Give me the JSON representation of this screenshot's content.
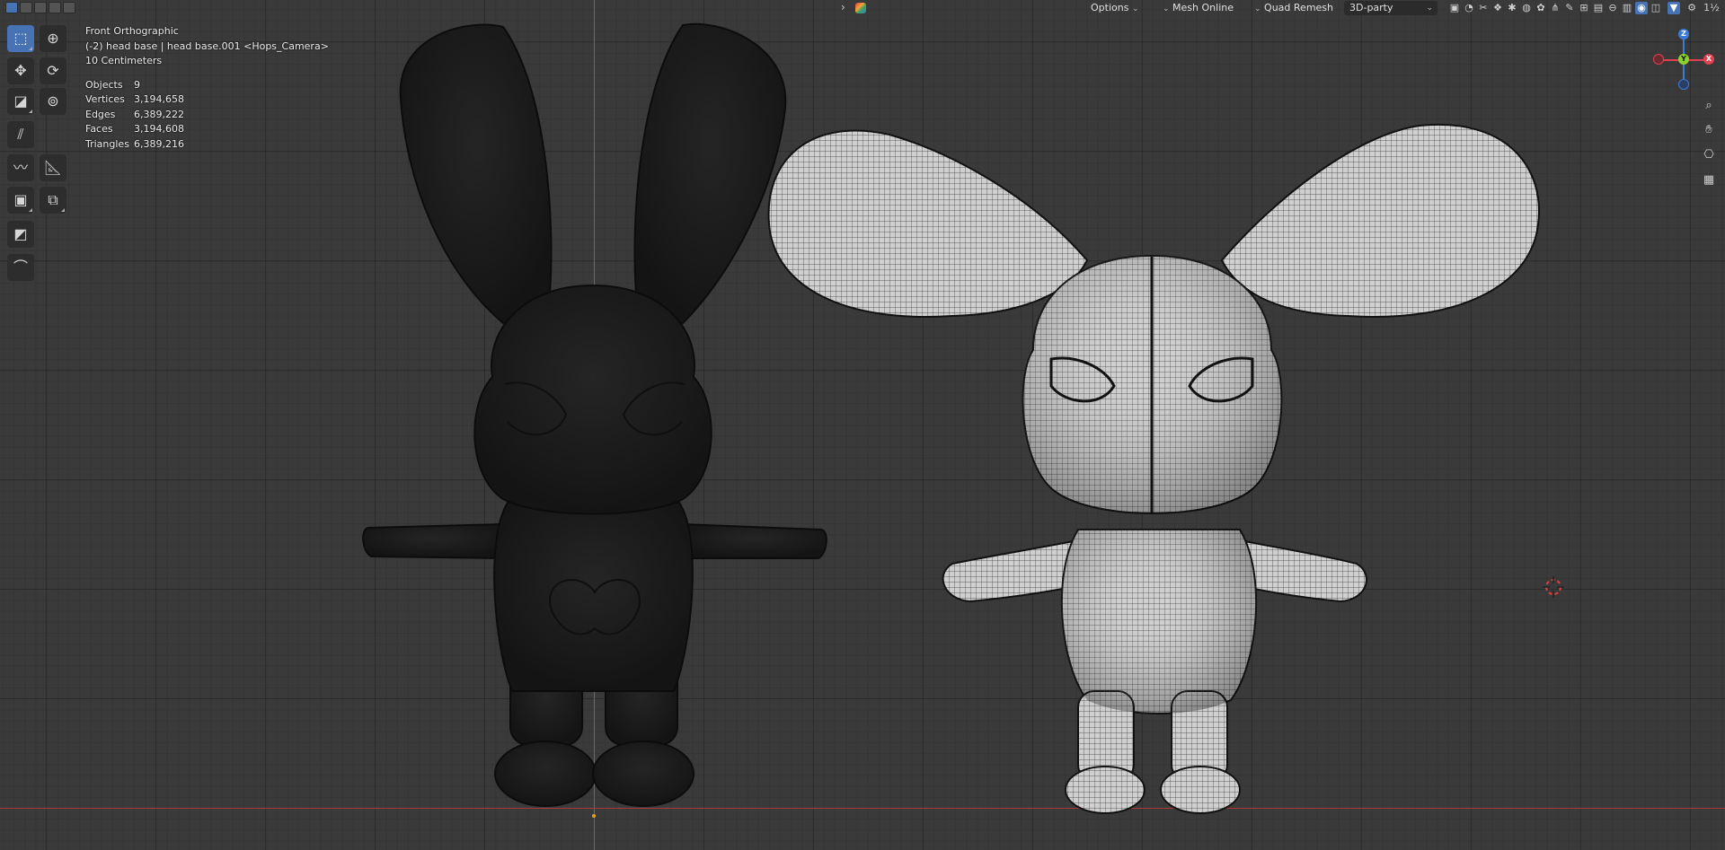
{
  "header": {
    "mode_icons": [
      "select-box-icon",
      "select-extend-icon",
      "select-subtract-icon",
      "select-invert-icon",
      "select-intersect-icon"
    ],
    "options_label": "Options",
    "mesh_online_label": "Mesh Online",
    "quad_remesh_label": "Quad Remesh",
    "addon_select_value": "3D-party",
    "right_icons": [
      "viewport-settings-icon",
      "gizmo-icon",
      "overlay-icon",
      "shading-wire-icon",
      "shading-solid-icon",
      "shading-material-icon",
      "shading-rendered-icon",
      "grass-icon",
      "pencil-icon",
      "mesh-icon",
      "image-icon",
      "hide-icon",
      "snap-icon",
      "camera-icon",
      "render-icon",
      "filter-icon",
      "gear-icon",
      "version-label"
    ],
    "version_text": "1½"
  },
  "toolbar": {
    "tools": [
      "select-box-icon",
      "cursor-icon",
      "move-icon",
      "rotate-icon",
      "scale-icon",
      "transform-icon",
      "annotate-icon",
      "draw-icon",
      "measure-icon",
      "add-cube-icon",
      "extrude-icon",
      "knife-icon",
      "bend-icon"
    ]
  },
  "overlay": {
    "view_name": "Front Orthographic",
    "object_info": "(-2) head base | head base.001 <Hops_Camera>",
    "grid_scale": "10 Centimeters",
    "stats": [
      {
        "label": "Objects",
        "value": "9"
      },
      {
        "label": "Vertices",
        "value": "3,194,658"
      },
      {
        "label": "Edges",
        "value": "6,389,222"
      },
      {
        "label": "Faces",
        "value": "3,194,608"
      },
      {
        "label": "Triangles",
        "value": "6,389,216"
      }
    ]
  },
  "gizmo": {
    "z_label": "Z",
    "y_label": "Y",
    "x_label": "X",
    "x_color": "#e0404f",
    "y_color": "#8bd130",
    "z_color": "#3c7bd6"
  },
  "nav_buttons": [
    "zoom-icon",
    "pan-hand-icon",
    "camera-view-icon",
    "ortho-grid-icon"
  ],
  "colors": {
    "selection_blue": "#4772b3",
    "viewport_bg": "#3a3a3a"
  }
}
